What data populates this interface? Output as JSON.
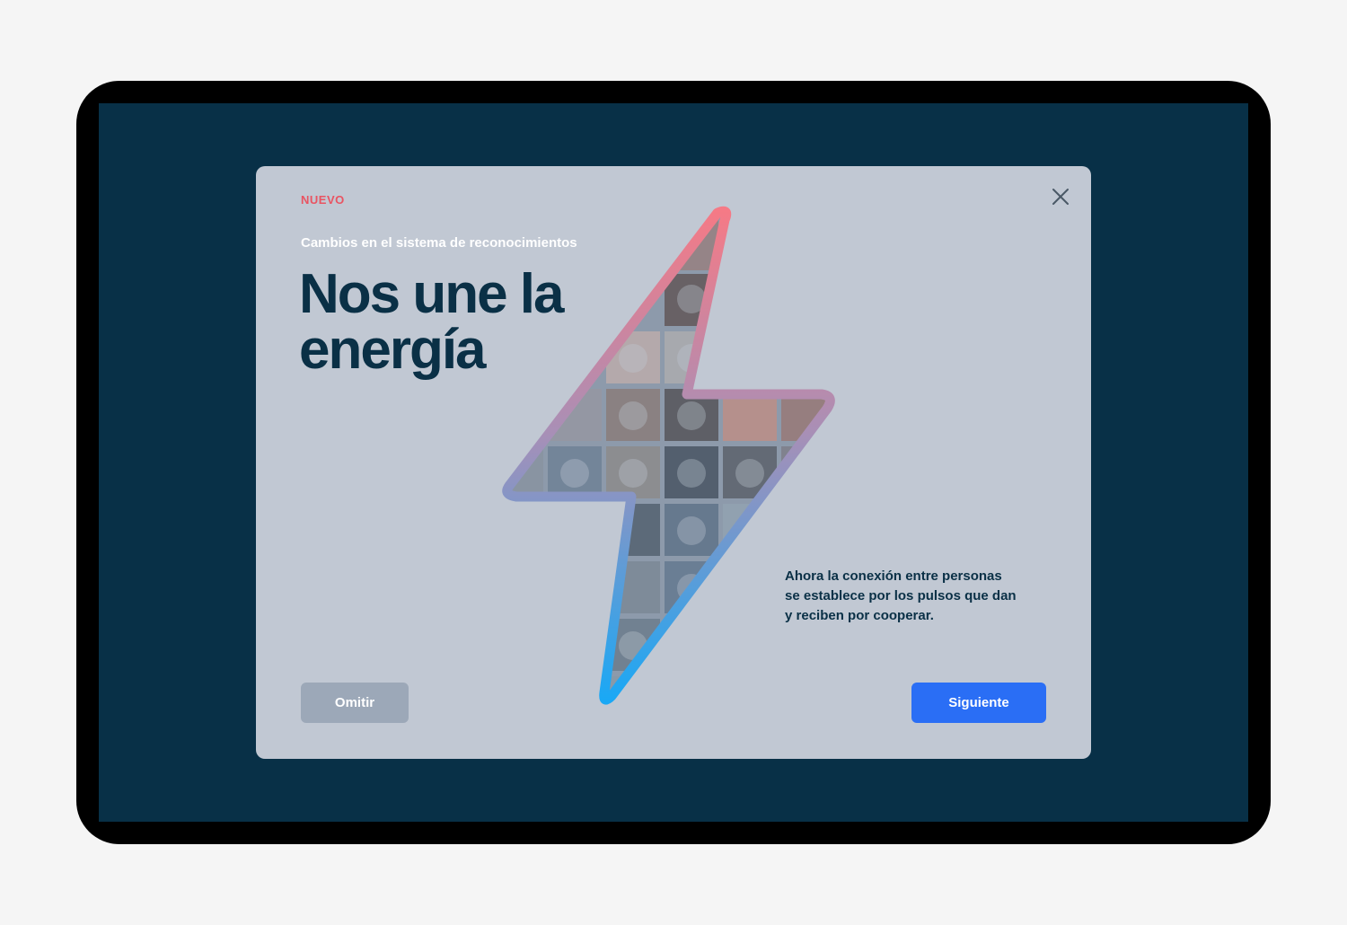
{
  "modal": {
    "badge": "NUEVO",
    "subtitle": "Cambios en el sistema de reconocimientos",
    "headline_line1": "Nos une la",
    "headline_line2": "energía",
    "description": "Ahora la conexión entre personas se establece por los pulsos que dan y reciben por cooperar.",
    "skip_label": "Omitir",
    "next_label": "Siguiente",
    "close_icon": "close-icon",
    "illustration_icon": "lightning-bolt-photo-collage"
  },
  "colors": {
    "screen_bg": "#083047",
    "modal_bg": "#c1c8d3",
    "badge": "#e95462",
    "headline": "#0a3046",
    "next_button": "#2a6ef5",
    "skip_button": "#9ca8b8",
    "bolt_gradient_top": "#f57a86",
    "bolt_gradient_bottom": "#1aa8f5"
  }
}
